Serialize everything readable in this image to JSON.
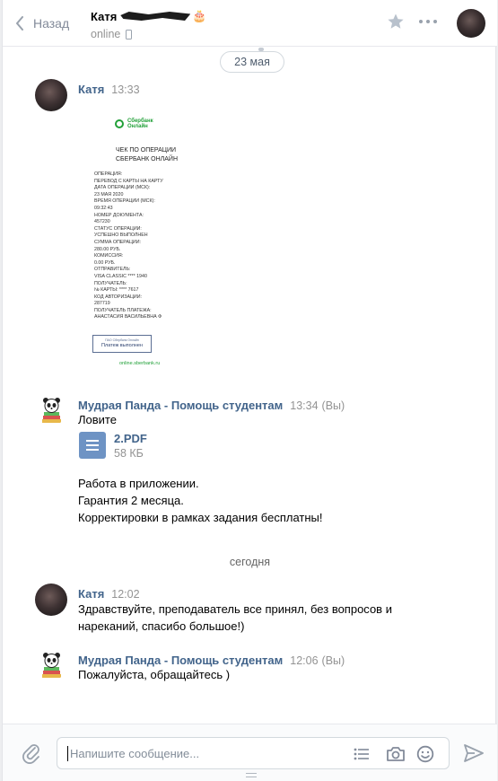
{
  "header": {
    "back_label": "Назад",
    "peer_name": "Катя",
    "peer_emoji": "🎂",
    "status": "online"
  },
  "date_pill": "23 мая",
  "messages": [
    {
      "author": "Катя",
      "time": "13:33",
      "attachment": {
        "kind": "receipt-image",
        "logo_line1": "Сбербанк",
        "logo_line2": "Онлайн",
        "title_line1": "ЧЕК ПО ОПЕРАЦИИ",
        "title_line2": "СБЕРБАНК ОНЛАЙН",
        "body": "ОПЕРАЦИЯ:\nПЕРЕВОД С КАРТЫ НА КАРТУ\nДАТА ОПЕРАЦИИ (МСК):\n23 МАЯ 2020\nВРЕМЯ ОПЕРАЦИИ (МСК):\n09:32:43\nНОМЕР ДОКУМЕНТА:\n457230\nСТАТУС ОПЕРАЦИИ:\nУСПЕШНО ВЫПОЛНЕН\nСУММА ОПЕРАЦИИ:\n280.00 РУБ.\nКОМИССИЯ:\n0.00 РУБ.\nОТПРАВИТЕЛЬ:\nVISA CLASSIC **** 1940\nПОЛУЧАТЕЛЬ:\n№ КАРТЫ: **** 7617\nКОД АВТОРИЗАЦИИ:\n287719\nПОЛУЧАТЕЛЬ ПЛАТЕЖА:\nАНАСТАСИЯ ВАСИЛЬЕВНА Ф",
        "stamp_small": "ПАО Сбербанк Онлайн",
        "stamp_main": "Платеж выполнен",
        "link": "online.sberbank.ru"
      }
    },
    {
      "author": "Мудрая Панда - Помощь студентам",
      "time": "13:34",
      "suffix": "(Вы)",
      "text1": "Ловите",
      "doc": {
        "name": "2.PDF",
        "size": "58 КБ"
      },
      "lines": [
        "Работа в приложении.",
        "Гарантия 2 месяца.",
        "Корректировки в рамках задания бесплатны!"
      ]
    }
  ],
  "separator": "сегодня",
  "messages_today": [
    {
      "author": "Катя",
      "time": "12:02",
      "lines": [
        "Здравствуйте, преподаватель все принял, без вопросов и",
        "нареканий, спасибо большое!)"
      ]
    },
    {
      "author": "Мудрая Панда - Помощь студентам",
      "time": "12:06",
      "suffix": "(Вы)",
      "lines": [
        "Пожалуйста, обращайтесь )"
      ]
    }
  ],
  "composer": {
    "placeholder": "Напишите сообщение..."
  },
  "colors": {
    "link": "#42648b",
    "muted": "#939393",
    "sber_green": "#21a038",
    "doc_icon": "#6e93c4"
  },
  "icons": [
    "back-arrow-icon",
    "phone-icon",
    "star-icon",
    "more-icon",
    "attach-icon",
    "list-icon",
    "camera-icon",
    "smile-icon",
    "send-icon"
  ]
}
